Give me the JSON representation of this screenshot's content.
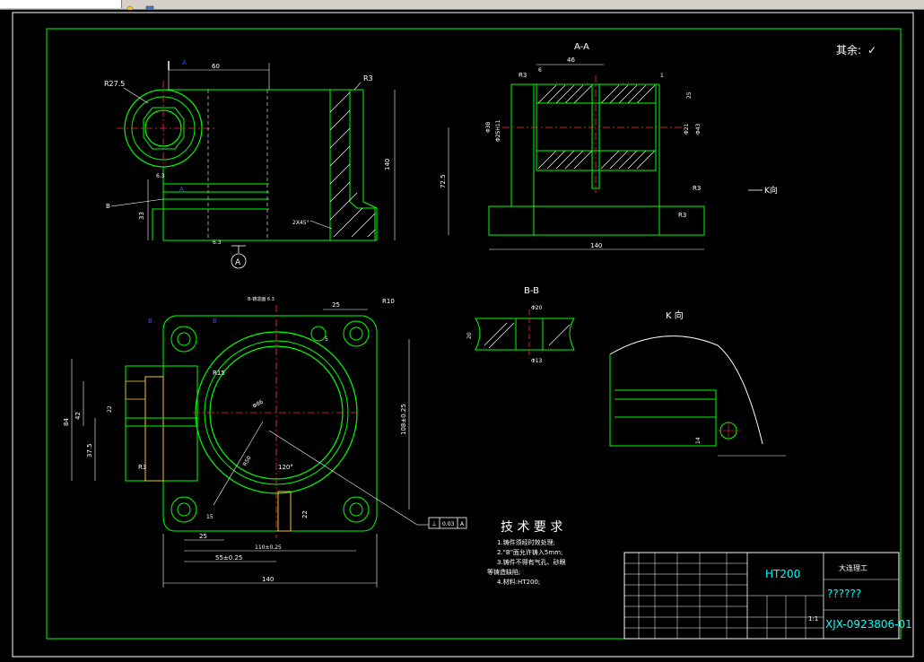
{
  "drawing": {
    "surface_note": "其余:",
    "check_symbol": "✓",
    "section_aa_title": "A-A",
    "section_bb_title": "B-B",
    "view_k_title": "K 向",
    "view_k_arrow_label": "K向",
    "section_marker_a": "A",
    "flatness_tolerance": "0.03",
    "datum_ref": "A"
  },
  "dimensions": {
    "r27_5": "R27.5",
    "r3_top": "R3",
    "d60": "60",
    "d140_vert": "140",
    "d33": "33",
    "chamfer": "2X45°",
    "a6_3": "6.3",
    "d46": "46",
    "r3_a": "R3",
    "d6_top": "6",
    "d1": "1",
    "d25_a": "25",
    "d38": "Φ38",
    "d25h": "Φ25H11",
    "d21": "Φ21",
    "d43": "Φ43",
    "d72_5": "72.5",
    "r3_b": "R3",
    "r3_c": "R3",
    "d140_h": "140",
    "r10": "R10",
    "d25_top": "25",
    "d5": "5",
    "r15": "R15",
    "r3_d": "R3",
    "d84": "84",
    "d42": "42",
    "d37_5": "37.5",
    "d22_h": "22",
    "d108": "108±0.25",
    "d25_bot": "25",
    "d110": "110±0.25",
    "d55": "55±0.25",
    "d140_bot": "140",
    "d22_v": "22",
    "phi_big": "Φ86",
    "r50": "R50",
    "ang120": "120°",
    "b_left": "B",
    "b_right": "B",
    "b_mid": "B",
    "phi20": "Φ20",
    "phi13": "Φ13",
    "d20_bb": "20",
    "d14": "14",
    "d15": "15"
  },
  "tech_requirements": {
    "title": "技 术 要 求",
    "lines": [
      "1.铸件须经时效处理;",
      "2.\"B\"面允许铸入5mm;",
      "3.铸件不得有气孔、砂眼",
      "等铸造缺陷;",
      "4.材料:HT200;"
    ]
  },
  "title_block": {
    "material": "HT200",
    "school": "大连理工",
    "name_placeholder": "??????",
    "drawing_number": "XJX-0923806-01",
    "scale": "1:1"
  }
}
